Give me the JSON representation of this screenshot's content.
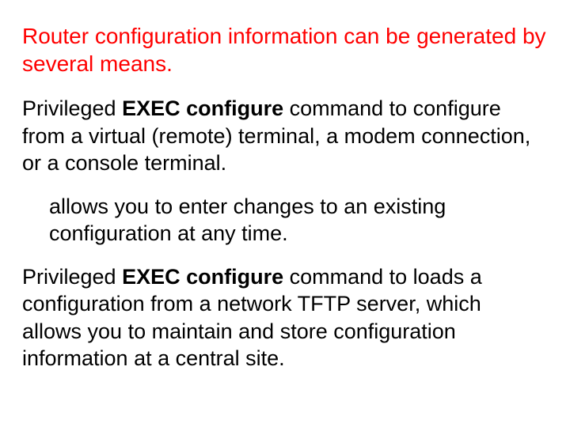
{
  "title": "Router configuration information can be generated by several means.",
  "p1": {
    "lead": "Privileged ",
    "bold": "EXEC configure",
    "rest": " command to configure from a virtual (remote) terminal, a modem connection, or a console terminal."
  },
  "p2": "allows you to enter changes to an existing configuration at any time.",
  "p3": {
    "lead": "Privileged ",
    "bold": "EXEC configure",
    "rest": " command to loads a configuration from a network TFTP server, which allows you to maintain and store configuration information at a central site."
  }
}
